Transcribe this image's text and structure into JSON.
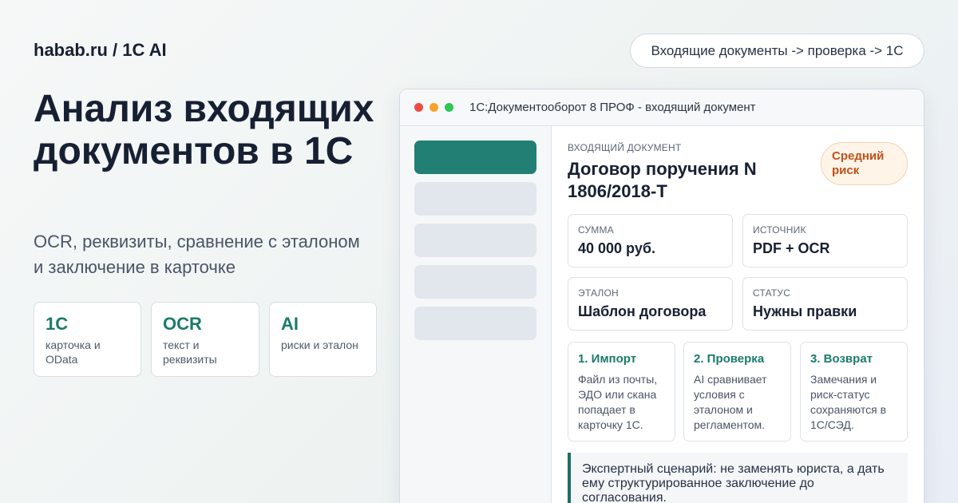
{
  "brand": "habab.ru / 1C AI",
  "flow_pill": "Входящие документы -> проверка -> 1С",
  "headline": "Анализ входящих документов в 1С",
  "subhead": "OCR, реквизиты, сравнение с эталоном и заключение в карточке",
  "stats": [
    {
      "value": "1С",
      "label": "карточка и OData"
    },
    {
      "value": "OCR",
      "label": "текст и реквизиты"
    },
    {
      "value": "AI",
      "label": "риски и эталон"
    }
  ],
  "window": {
    "title": "1С:Документооборот 8 ПРОФ - входящий документ",
    "dot_colors": [
      "#ee4b45",
      "#f4a52a",
      "#2fc655"
    ]
  },
  "document": {
    "kicker": "ВХОДЯЩИЙ ДОКУМЕНТ",
    "title": "Договор поручения N 1806/2018-Т",
    "risk": "Средний риск",
    "fields": [
      {
        "label": "СУММА",
        "value": "40 000 руб."
      },
      {
        "label": "ИСТОЧНИК",
        "value": "PDF + OCR"
      },
      {
        "label": "ЭТАЛОН",
        "value": "Шаблон договора"
      },
      {
        "label": "СТАТУС",
        "value": "Нужны правки"
      }
    ],
    "steps": [
      {
        "title": "1. Импорт",
        "text": "Файл из почты, ЭДО или скана попадает в карточку 1С."
      },
      {
        "title": "2. Проверка",
        "text": "AI сравнивает условия с эталоном и регламентом."
      },
      {
        "title": "3. Возврат",
        "text": "Замечания и риск-статус сохраняются в 1С/СЭД."
      }
    ],
    "note": "Экспертный сценарий: не заменять юриста, а дать ему структурированное заключение до согласования."
  },
  "colors": {
    "accent": "#1b7a6b",
    "sidebar_active": "#217f73",
    "risk_text": "#c2501a",
    "risk_bg": "#fff4e8"
  }
}
